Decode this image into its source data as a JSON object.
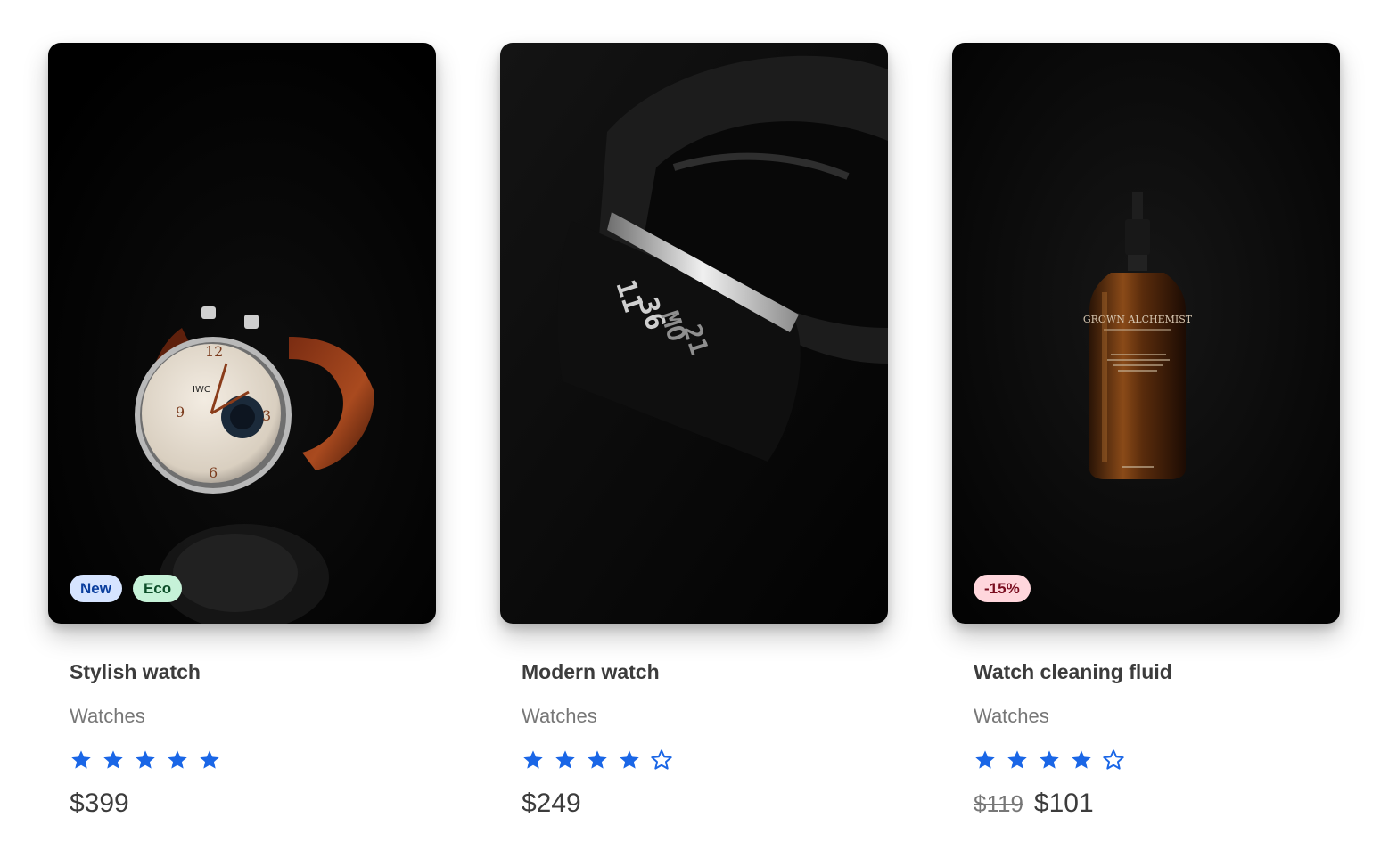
{
  "products": [
    {
      "title": "Stylish watch",
      "category": "Watches",
      "badges": [
        "New",
        "Eco"
      ],
      "rating": 5,
      "rating_max": 5,
      "price": "$399"
    },
    {
      "title": "Modern watch",
      "category": "Watches",
      "badges": [],
      "rating": 4,
      "rating_max": 5,
      "price": "$249"
    },
    {
      "title": "Watch cleaning fluid",
      "category": "Watches",
      "badges": [
        "-15%"
      ],
      "rating": 4,
      "rating_max": 5,
      "old_price": "$119",
      "price": "$101"
    }
  ],
  "image_text": {
    "watch_brand": "IWC",
    "band_display": [
      "11",
      "36",
      "MO",
      "21"
    ],
    "bottle_brand": "GROWN ALCHEMIST"
  },
  "colors": {
    "star": "#1a66e6",
    "text_primary": "#3c3c3c",
    "text_secondary": "#777777"
  }
}
